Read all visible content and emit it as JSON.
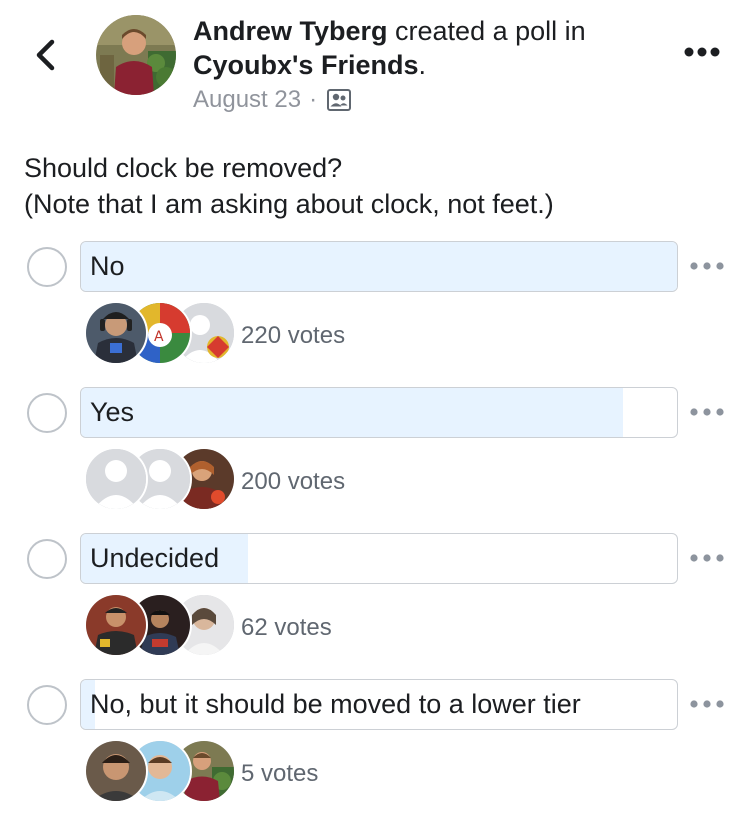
{
  "post": {
    "author": "Andrew Tyberg",
    "action": " created a poll in",
    "group": "Cyoubx's Friends",
    "group_suffix": ".",
    "date": "August 23",
    "separator": "·",
    "audience_icon": "group-icon",
    "back_icon": "chevron-left-icon",
    "more_icon": "more-horizontal-icon"
  },
  "poll": {
    "question_line1": "Should clock be removed?",
    "question_line2": "(Note that I am asking about clock, not feet.)",
    "options": [
      {
        "label": "No",
        "votes": "220 votes",
        "share": 1.0,
        "voter_avatars": [
          "photo",
          "game-logo",
          "game-logo-with-default"
        ]
      },
      {
        "label": "Yes",
        "votes": "200 votes",
        "share": 0.91,
        "voter_avatars": [
          "default",
          "default",
          "photo"
        ]
      },
      {
        "label": "Undecided",
        "votes": "62 votes",
        "share": 0.28,
        "voter_avatars": [
          "photo",
          "photo",
          "photo"
        ]
      },
      {
        "label": "No, but it should be moved to a lower tier",
        "votes": "5 votes",
        "share": 0.023,
        "voter_avatars": [
          "photo",
          "photo",
          "photo"
        ]
      }
    ]
  },
  "colors": {
    "bar_fill": "#e7f3ff",
    "bar_border": "#ccd0d5",
    "radio_border": "#bec3c9",
    "meta_text": "#90949c",
    "votes_text": "#606770"
  }
}
